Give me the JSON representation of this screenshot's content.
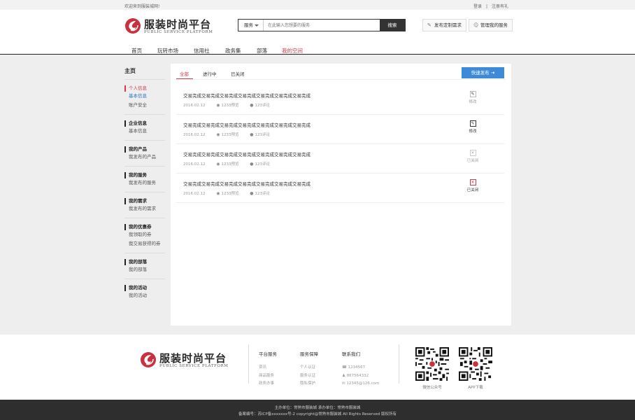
{
  "topbar": {
    "welcome": "欢迎来到服装城网!",
    "login": "登录",
    "divider": "|",
    "register": "注册有礼"
  },
  "brand": {
    "name_cn": "服装时尚平台",
    "name_en": "PUBLIC SERVICE PLATFORM"
  },
  "search": {
    "category": "服务",
    "placeholder": "在此输入您想要的服务",
    "button": "搜索"
  },
  "header_buttons": {
    "publish_demand": "发布定制需求",
    "manage_service": "管理我的服务"
  },
  "nav": [
    "首页",
    "玩转市场",
    "信用社",
    "政务集",
    "部落",
    "我的空间"
  ],
  "sidebar": {
    "home": "主页",
    "groups": [
      {
        "title": "个人信息",
        "links": [
          "基本信息",
          "账户安全"
        ]
      },
      {
        "title": "企业信息",
        "links": [
          "基本信息"
        ]
      },
      {
        "title": "我的产品",
        "links": [
          "我发布的产品"
        ]
      },
      {
        "title": "我的服务",
        "links": [
          "我发布的服务"
        ]
      },
      {
        "title": "我的需求",
        "links": [
          "我发布的需求"
        ]
      },
      {
        "title": "我的优惠券",
        "links": [
          "我领取的券",
          "我交易获得的券"
        ]
      },
      {
        "title": "我的部落",
        "links": [
          "我的部落"
        ]
      },
      {
        "title": "我的活动",
        "links": [
          "我的活动"
        ]
      }
    ]
  },
  "tabs": [
    "全部",
    "进行中",
    "已关闭"
  ],
  "quick_publish": "快速发布",
  "rows": [
    {
      "title": "交易完成交易完成交易完成交易完成交易完成交易完成交易完成",
      "date": "2016.02.12",
      "views": "1233预览",
      "comments": "123评论",
      "action": "修改",
      "action_icon": "edit-icon"
    },
    {
      "title": "交易完成交易完成交易完成交易完成交易完成交易完成交易完成",
      "date": "2016.02.12",
      "views": "1233预览",
      "comments": "123评论",
      "action": "修改",
      "action_icon": "edit-icon"
    },
    {
      "title": "交易完成交易完成交易完成交易完成交易完成交易完成交易完成",
      "date": "2016.02.12",
      "views": "1233预览",
      "comments": "123评论",
      "action": "已关闭",
      "action_icon": "close-icon"
    },
    {
      "title": "交易完成交易完成交易完成交易完成交易完成交易完成交易完成",
      "date": "2016.02.12",
      "views": "1233预览",
      "comments": "123评论",
      "action": "已关闭",
      "action_icon": "close-icon"
    }
  ],
  "footer": {
    "col1": {
      "title": "平台服务",
      "links": [
        "资讯",
        "商品服务",
        "政务办事"
      ]
    },
    "col2": {
      "title": "服务保障",
      "links": [
        "个人认证",
        "服务认证",
        "隐私保护"
      ]
    },
    "col3": {
      "title": "联系我们",
      "phone": "1234567",
      "qq": "867564332",
      "email": "12345@126.com"
    },
    "qr1": "微信公众号",
    "qr2": "APP下载"
  },
  "bottom": {
    "line1": "主办单位：常熟市服装城      承办单位：常熟市服装城",
    "line2": "备案编号：苏ICP备xxxxxxx号-2 copyright@常熟市服装城   All Rights Reserved 版权所有"
  },
  "colors": {
    "accent": "#d33a4a",
    "link": "#2a72c4",
    "primary_button": "#3d8ad8",
    "bottom_bar": "#2e2e2e"
  }
}
